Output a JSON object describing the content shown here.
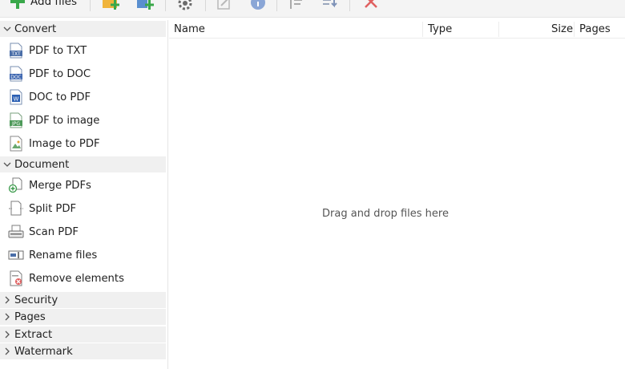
{
  "toolbar": {
    "add_files_label": "Add files",
    "buttons": [
      {
        "icon": "add-folder-icon"
      },
      {
        "icon": "add-files-plus-icon"
      },
      {
        "icon": "settings-icon"
      },
      {
        "icon": "edit-icon"
      },
      {
        "icon": "info-icon"
      },
      {
        "icon": "sort-icon"
      },
      {
        "icon": "move-down-icon"
      },
      {
        "icon": "remove-icon"
      }
    ],
    "colors": {
      "add": "#3aa84a",
      "remove": "#e06060",
      "info": "#8aa6d6"
    }
  },
  "sidebar": {
    "groups": [
      {
        "label": "Convert",
        "expanded": true,
        "items": [
          {
            "label": "PDF to TXT",
            "icon": "txt-file-icon"
          },
          {
            "label": "PDF to DOC",
            "icon": "doc-file-icon"
          },
          {
            "label": "DOC to PDF",
            "icon": "word-file-icon"
          },
          {
            "label": "PDF to image",
            "icon": "jpg-file-icon"
          },
          {
            "label": "Image to PDF",
            "icon": "image-file-icon"
          }
        ]
      },
      {
        "label": "Document",
        "expanded": true,
        "items": [
          {
            "label": "Merge PDFs",
            "icon": "merge-icon"
          },
          {
            "label": "Split PDF",
            "icon": "split-icon"
          },
          {
            "label": "Scan PDF",
            "icon": "scanner-icon"
          },
          {
            "label": "Rename files",
            "icon": "rename-icon"
          },
          {
            "label": "Remove elements",
            "icon": "remove-elements-icon"
          }
        ]
      },
      {
        "label": "Security",
        "expanded": false
      },
      {
        "label": "Pages",
        "expanded": false
      },
      {
        "label": "Extract",
        "expanded": false
      },
      {
        "label": "Watermark",
        "expanded": false
      }
    ]
  },
  "file_list": {
    "columns": [
      {
        "label": "Name"
      },
      {
        "label": "Type"
      },
      {
        "label": "Size"
      },
      {
        "label": "Pages"
      }
    ],
    "empty_text": "Drag and drop files here"
  }
}
